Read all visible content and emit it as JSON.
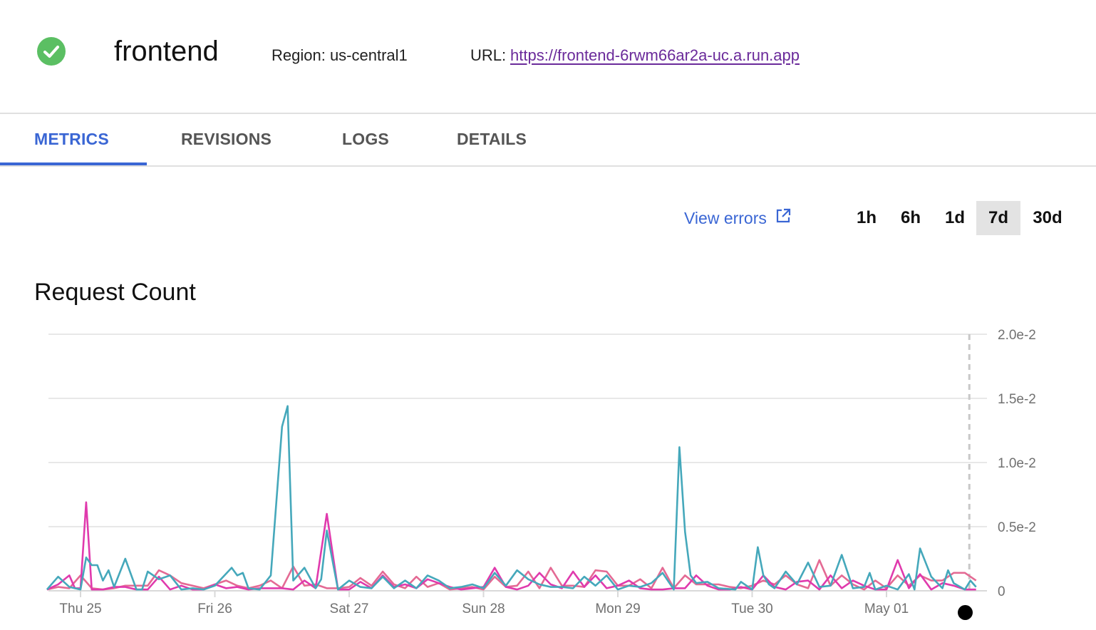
{
  "header": {
    "status_icon": "check-circle-icon",
    "status_color": "#5bbf63",
    "service_name": "frontend",
    "region": "Region: us-central1",
    "url_label": "URL:",
    "url": "https://frontend-6rwm66ar2a-uc.a.run.app"
  },
  "tabs": [
    {
      "label": "METRICS",
      "active": true
    },
    {
      "label": "REVISIONS",
      "active": false
    },
    {
      "label": "LOGS",
      "active": false
    },
    {
      "label": "DETAILS",
      "active": false
    }
  ],
  "toolbar": {
    "view_errors_label": "View errors",
    "view_errors_icon": "external-link-icon",
    "time_ranges": [
      {
        "label": "1h",
        "selected": false
      },
      {
        "label": "6h",
        "selected": false
      },
      {
        "label": "1d",
        "selected": false
      },
      {
        "label": "7d",
        "selected": true
      },
      {
        "label": "30d",
        "selected": false
      }
    ]
  },
  "colors": {
    "accent": "#3a66d4",
    "link_visited": "#6a2a9a",
    "series_teal": "#45a8bb",
    "series_magenta": "#e03aad",
    "series_pink": "#e46a94"
  },
  "chart_data": {
    "type": "line",
    "title": "Request Count",
    "xlabel": "",
    "ylabel": "",
    "x_unit": "hours since Thu 25 00:00",
    "xlim": [
      -6.5,
      161
    ],
    "ylim": [
      0,
      0.02
    ],
    "y_ticks": [
      {
        "value": 0,
        "label": "0"
      },
      {
        "value": 0.005,
        "label": "0.5e-2"
      },
      {
        "value": 0.01,
        "label": "1.0e-2"
      },
      {
        "value": 0.015,
        "label": "1.5e-2"
      },
      {
        "value": 0.02,
        "label": "2.0e-2"
      }
    ],
    "y_axis_position": "right",
    "x_ticks": [
      {
        "value": 0,
        "label": "Thu 25"
      },
      {
        "value": 24,
        "label": "Fri 26"
      },
      {
        "value": 48,
        "label": "Sat 27"
      },
      {
        "value": 72,
        "label": "Sun 28"
      },
      {
        "value": 96,
        "label": "Mon 29"
      },
      {
        "value": 120,
        "label": "Tue 30"
      },
      {
        "value": 144,
        "label": "May 01"
      }
    ],
    "grid": true,
    "cursor_x": 158.8,
    "series": [
      {
        "name": "teal",
        "color": "#45a8bb",
        "x": [
          -6,
          -4,
          -2,
          0,
          1,
          2,
          3,
          4,
          5,
          6,
          8,
          10,
          11,
          12,
          14,
          16,
          18,
          20,
          22,
          24,
          27,
          28,
          29,
          30,
          32,
          34,
          36,
          37,
          38,
          40,
          42,
          43,
          44,
          46,
          48,
          50,
          52,
          54,
          56,
          58,
          60,
          62,
          64,
          66,
          68,
          70,
          72,
          74,
          76,
          78,
          80,
          82,
          84,
          86,
          88,
          90,
          92,
          94,
          96,
          98,
          100,
          102,
          104,
          106,
          107,
          108,
          109,
          110,
          112,
          114,
          117,
          118,
          120,
          121,
          122,
          123,
          124,
          126,
          128,
          130,
          132,
          134,
          136,
          138,
          140,
          141,
          142,
          144,
          146,
          148,
          149,
          150,
          152,
          154,
          155,
          156,
          158,
          159,
          160
        ],
        "y": [
          0.0001,
          0.0011,
          0.0003,
          0.0001,
          0.0026,
          0.002,
          0.002,
          0.0008,
          0.0016,
          0.0003,
          0.0025,
          0.0001,
          0.0001,
          0.0015,
          0.0009,
          0.0012,
          0.0001,
          0.0002,
          0.0001,
          0.0004,
          0.0018,
          0.0012,
          0.0014,
          0.0002,
          0.0001,
          0.0012,
          0.0128,
          0.0144,
          0.0008,
          0.0018,
          0.0002,
          0.0009,
          0.0047,
          0.0001,
          0.0008,
          0.0003,
          0.0002,
          0.0011,
          0.0002,
          0.0008,
          0.0002,
          0.0012,
          0.0008,
          0.0002,
          0.0003,
          0.0005,
          0.0002,
          0.0014,
          0.0004,
          0.0016,
          0.0009,
          0.0005,
          0.0003,
          0.0003,
          0.0002,
          0.0011,
          0.0004,
          0.0012,
          0.0001,
          0.0004,
          0.0003,
          0.0006,
          0.0014,
          0.0001,
          0.0112,
          0.0046,
          0.0012,
          0.0006,
          0.0007,
          0.0002,
          0.0001,
          0.0007,
          0.0001,
          0.0034,
          0.0012,
          0.0005,
          0.0002,
          0.0015,
          0.0005,
          0.0022,
          0.0003,
          0.0004,
          0.0028,
          0.0002,
          0.0003,
          0.0014,
          0.0001,
          0.0004,
          0.0001,
          0.0013,
          0.0001,
          0.0033,
          0.0011,
          0.0002,
          0.0016,
          0.0006,
          0.0001,
          0.0008,
          0.0003
        ]
      },
      {
        "name": "magenta",
        "color": "#e03aad",
        "x": [
          -6,
          -4,
          -2,
          -1,
          0,
          1,
          2,
          4,
          6,
          8,
          10,
          12,
          14,
          16,
          18,
          20,
          22,
          24,
          26,
          28,
          30,
          32,
          34,
          36,
          38,
          40,
          42,
          44,
          46,
          48,
          50,
          52,
          54,
          56,
          58,
          60,
          62,
          64,
          66,
          68,
          70,
          72,
          74,
          76,
          78,
          80,
          82,
          84,
          86,
          88,
          90,
          92,
          94,
          96,
          98,
          100,
          102,
          104,
          106,
          108,
          110,
          112,
          114,
          116,
          118,
          120,
          122,
          124,
          126,
          128,
          130,
          132,
          134,
          136,
          138,
          140,
          142,
          144,
          146,
          148,
          150,
          152,
          154,
          156,
          158,
          160
        ],
        "y": [
          0.0001,
          0.0005,
          0.0012,
          0.0002,
          0.0002,
          0.0069,
          0.0001,
          0.0001,
          0.0003,
          0.0003,
          0.0001,
          0.0001,
          0.0011,
          0.0001,
          0.0004,
          0.0001,
          0.0001,
          0.0005,
          0.0002,
          0.0003,
          0.0001,
          0.0002,
          0.0002,
          0.0002,
          0.0001,
          0.0008,
          0.0002,
          0.006,
          0.0001,
          0.0001,
          0.0007,
          0.0002,
          0.0012,
          0.0003,
          0.0005,
          0.0002,
          0.0009,
          0.0006,
          0.0003,
          0.0001,
          0.0002,
          0.0003,
          0.0018,
          0.0003,
          0.0001,
          0.0004,
          0.0014,
          0.0005,
          0.0002,
          0.0015,
          0.0003,
          0.0012,
          0.0002,
          0.0004,
          0.0008,
          0.0002,
          0.0001,
          0.0001,
          0.0002,
          0.0002,
          0.0012,
          0.0004,
          0.0001,
          0.0001,
          0.0003,
          0.0001,
          0.0012,
          0.0003,
          0.0001,
          0.0007,
          0.0008,
          0.0001,
          0.0012,
          0.0002,
          0.0008,
          0.0004,
          0.0001,
          0.0001,
          0.0024,
          0.0002,
          0.0013,
          0.0001,
          0.0006,
          0.0004,
          0.0001,
          0.0001
        ]
      },
      {
        "name": "pink",
        "color": "#e46a94",
        "x": [
          -6,
          -4,
          -2,
          0,
          2,
          4,
          6,
          8,
          10,
          12,
          14,
          16,
          18,
          20,
          22,
          24,
          26,
          28,
          30,
          32,
          34,
          36,
          38,
          40,
          42,
          44,
          46,
          48,
          50,
          52,
          54,
          56,
          58,
          60,
          62,
          64,
          66,
          68,
          70,
          72,
          74,
          76,
          78,
          80,
          82,
          84,
          86,
          88,
          90,
          92,
          94,
          96,
          98,
          100,
          102,
          104,
          106,
          108,
          110,
          112,
          114,
          116,
          118,
          120,
          122,
          124,
          126,
          128,
          130,
          132,
          134,
          136,
          138,
          140,
          142,
          144,
          146,
          148,
          150,
          152,
          154,
          156,
          158,
          160
        ],
        "y": [
          0.0001,
          0.0003,
          0.0002,
          0.0012,
          0.0002,
          0.0001,
          0.0002,
          0.0004,
          0.0004,
          0.0004,
          0.0016,
          0.0012,
          0.0006,
          0.0004,
          0.0002,
          0.0005,
          0.0008,
          0.0004,
          0.0002,
          0.0004,
          0.0008,
          0.0002,
          0.0019,
          0.0004,
          0.0005,
          0.0002,
          0.0002,
          0.0003,
          0.001,
          0.0004,
          0.0015,
          0.0005,
          0.0002,
          0.0011,
          0.0003,
          0.0006,
          0.0001,
          0.0002,
          0.0003,
          0.0001,
          0.0011,
          0.0003,
          0.0004,
          0.0015,
          0.0002,
          0.0018,
          0.0004,
          0.0004,
          0.0003,
          0.0016,
          0.0015,
          0.0004,
          0.0004,
          0.0009,
          0.0002,
          0.0018,
          0.0002,
          0.0012,
          0.0005,
          0.0005,
          0.0005,
          0.0003,
          0.0002,
          0.0004,
          0.0008,
          0.0005,
          0.0012,
          0.0005,
          0.0002,
          0.0024,
          0.0004,
          0.0012,
          0.0005,
          0.0001,
          0.0008,
          0.0002,
          0.0012,
          0.0004,
          0.0012,
          0.0008,
          0.0008,
          0.0014,
          0.0014,
          0.0008
        ]
      }
    ]
  }
}
